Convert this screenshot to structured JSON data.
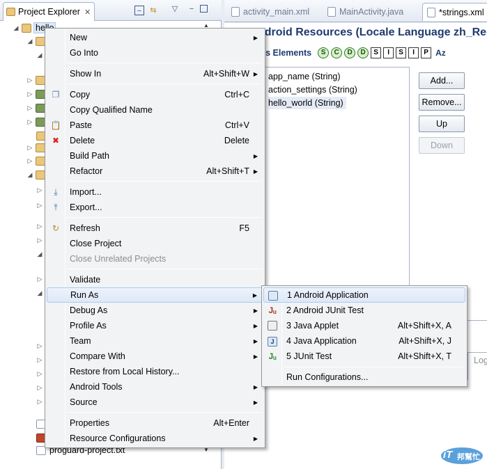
{
  "explorer": {
    "tab_label": "Project Explorer",
    "root_item": "hello",
    "bottom_file": "proguard-project.txt"
  },
  "editor": {
    "tabs": [
      {
        "label": "activity_main.xml",
        "active": false
      },
      {
        "label": "MainActivity.java",
        "active": false
      },
      {
        "label": "*strings.xml",
        "active": true
      }
    ],
    "title": "ndroid Resources (Locale Language zh_Regi",
    "elements_header": "tes Elements",
    "filter_circles": [
      "S",
      "C",
      "D",
      "D"
    ],
    "filter_squares": [
      "S",
      "I",
      "S",
      "I",
      "P"
    ],
    "sort_label": "Az",
    "resources": [
      {
        "label": "app_name (String)"
      },
      {
        "label": "action_settings (String)"
      },
      {
        "label": "hello_world (String)",
        "selected": true
      }
    ],
    "buttons": {
      "add": "Add...",
      "remove": "Remove...",
      "up": "Up",
      "down": "Down"
    },
    "log_partial": "Log"
  },
  "context_menu": {
    "new": "New",
    "go_into": "Go Into",
    "show_in": {
      "label": "Show In",
      "shortcut": "Alt+Shift+W"
    },
    "copy": {
      "label": "Copy",
      "shortcut": "Ctrl+C"
    },
    "copy_qualified_name": "Copy Qualified Name",
    "paste": {
      "label": "Paste",
      "shortcut": "Ctrl+V"
    },
    "delete": {
      "label": "Delete",
      "shortcut": "Delete"
    },
    "build_path": "Build Path",
    "refactor": {
      "label": "Refactor",
      "shortcut": "Alt+Shift+T"
    },
    "import": "Import...",
    "export": "Export...",
    "refresh": {
      "label": "Refresh",
      "shortcut": "F5"
    },
    "close_project": "Close Project",
    "close_unrelated_projects": "Close Unrelated Projects",
    "validate": "Validate",
    "run_as": "Run As",
    "debug_as": "Debug As",
    "profile_as": "Profile As",
    "team": "Team",
    "compare_with": "Compare With",
    "restore_from_local_history": "Restore from Local History...",
    "android_tools": "Android Tools",
    "source": "Source",
    "properties": {
      "label": "Properties",
      "shortcut": "Alt+Enter"
    },
    "resource_configurations": "Resource Configurations"
  },
  "run_as_submenu": {
    "android_application": "1 Android Application",
    "android_junit_test": "2 Android JUnit Test",
    "java_applet": {
      "label": "3 Java Applet",
      "shortcut": "Alt+Shift+X, A"
    },
    "java_application": {
      "label": "4 Java Application",
      "shortcut": "Alt+Shift+X, J"
    },
    "junit_test": {
      "label": "5 JUnit Test",
      "shortcut": "Alt+Shift+X, T"
    },
    "run_configurations": "Run Configurations..."
  },
  "watermark": {
    "line1": "iT",
    "line2": "邦幫忙"
  },
  "colors": {
    "menu_bg": "#f2f3f5",
    "menu_highlight": "#dde8f7",
    "title_blue": "#1f3a70",
    "panel_border": "#a6b3c7"
  }
}
